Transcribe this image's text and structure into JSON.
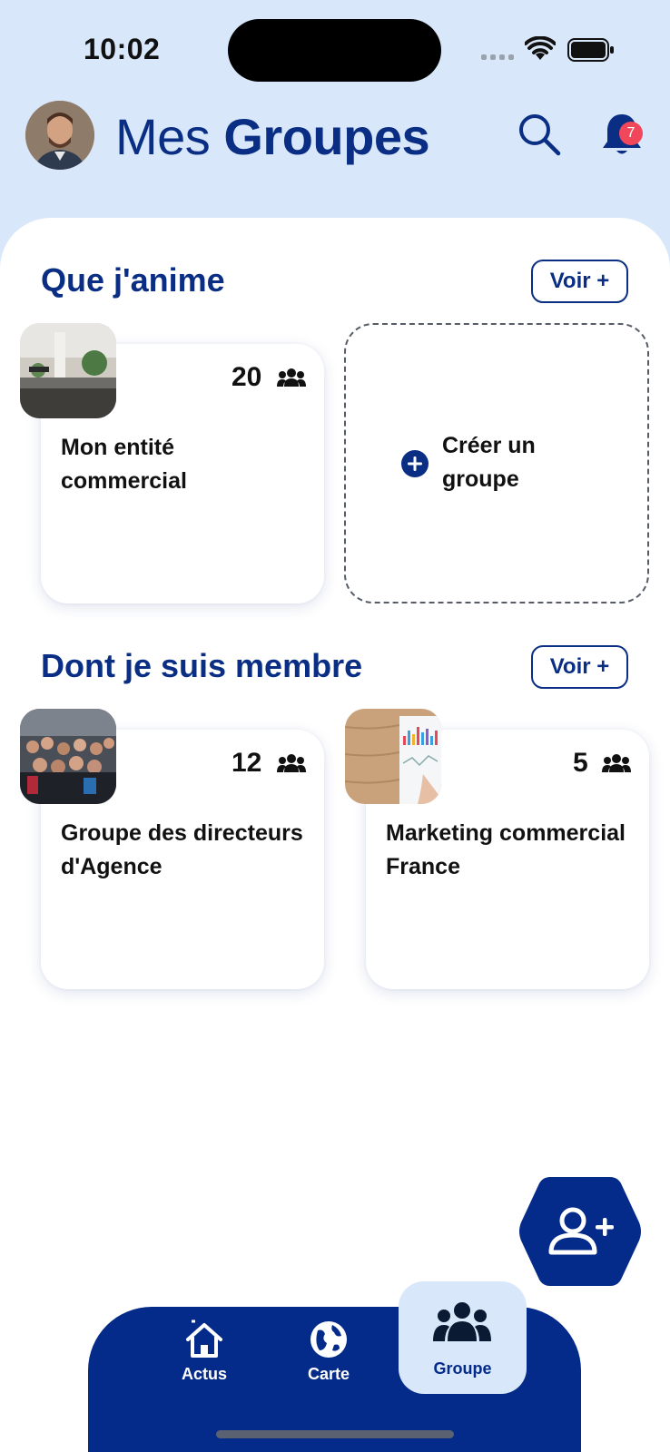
{
  "status_bar": {
    "time": "10:02"
  },
  "header": {
    "title_light": "Mes",
    "title_bold": "Groupes",
    "notification_count": "7",
    "icons": [
      "avatar",
      "search-icon",
      "bell-icon"
    ]
  },
  "sections": {
    "animated": {
      "title": "Que j'anime",
      "see_more_label": "Voir +"
    },
    "member": {
      "title": "Dont je suis membre",
      "see_more_label": "Voir +"
    }
  },
  "groups_animated": [
    {
      "name": "Mon entité commercial",
      "members": "20",
      "thumb": "office"
    }
  ],
  "create_group": {
    "label": "Créer un groupe",
    "icon": "plus-circle-icon"
  },
  "groups_member": [
    {
      "name": "Groupe des directeurs d'Agence",
      "members": "12",
      "thumb": "crowd"
    },
    {
      "name": "Marketing commercial France",
      "members": "5",
      "thumb": "chart-paper"
    }
  ],
  "fab": {
    "icon": "add-user-icon"
  },
  "bottom_nav": {
    "items": [
      {
        "label": "Actus",
        "icon": "home-icon"
      },
      {
        "label": "Carte",
        "icon": "globe-icon"
      },
      {
        "label": "Groupe",
        "icon": "group-icon",
        "active": true
      }
    ]
  },
  "colors": {
    "primary": "#0a2e84",
    "nav": "#052b8a",
    "background": "#d8e7f9",
    "badge": "#f0475a"
  }
}
